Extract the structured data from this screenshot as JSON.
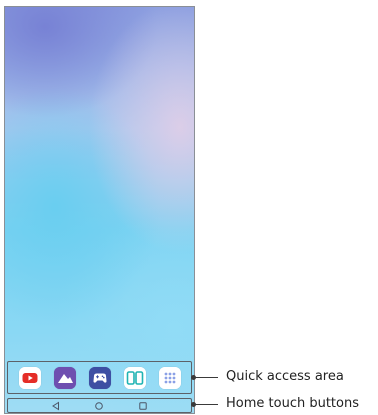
{
  "callouts": {
    "quick_access_label": "Quick access area",
    "home_buttons_label": "Home touch buttons"
  },
  "quick_access": {
    "apps": [
      {
        "name": "youtube-icon",
        "color": "#e52d27"
      },
      {
        "name": "gallery-icon",
        "color": "#6e4fb0"
      },
      {
        "name": "game-controller-icon",
        "color": "#3d4fa3"
      },
      {
        "name": "dual-window-icon",
        "color": "#1fb3b3"
      },
      {
        "name": "app-drawer-icon",
        "color": "#8aa0e6"
      }
    ]
  },
  "home_buttons": {
    "items": [
      {
        "name": "back-icon"
      },
      {
        "name": "home-icon"
      },
      {
        "name": "recents-icon"
      }
    ]
  }
}
